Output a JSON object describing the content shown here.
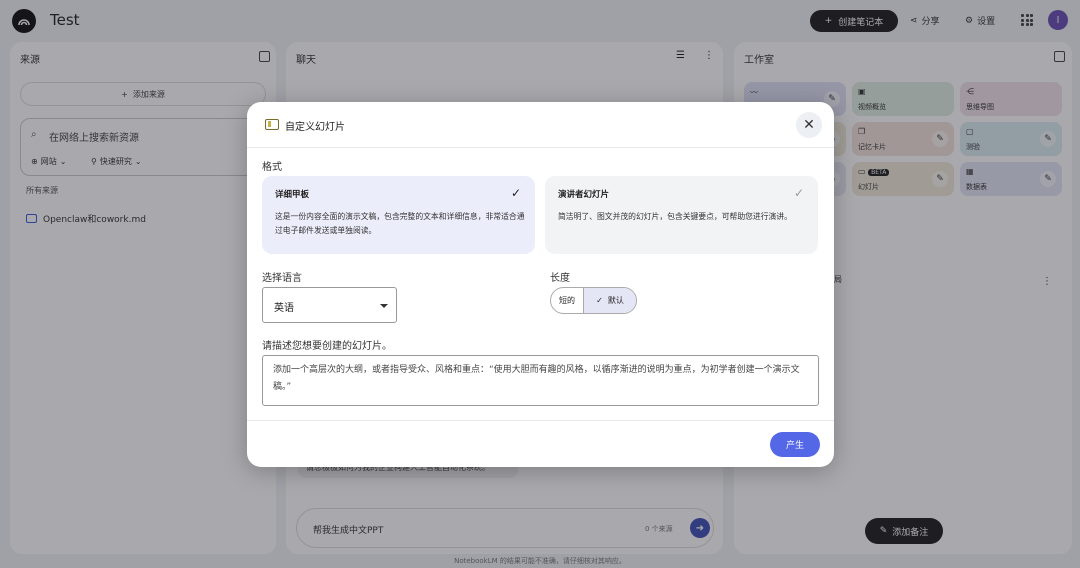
{
  "app": {
    "notebook_title": "Test",
    "create_label": "创建笔记本",
    "share_label": "分享",
    "settings_label": "设置",
    "avatar_initial": "I"
  },
  "sources": {
    "title": "来源",
    "add_label": "添加来源",
    "search_placeholder": "在网络上搜索新资源",
    "chip_web": "网站",
    "chip_research": "快速研究",
    "all_sources": "所有来源",
    "items": [
      {
        "name": "Openclaw和cowork.md"
      }
    ]
  },
  "chat": {
    "title": "聊天",
    "bubble_text": "请您极极如何为我的企业构建人工智能自动化系统。",
    "input_value": "帮我生成中文PPT",
    "source_count": "0 个来源"
  },
  "studio": {
    "title": "工作室",
    "tiles": [
      {
        "label": "",
        "icon": "audio-icon"
      },
      {
        "label": "视频概览",
        "icon": "video-icon"
      },
      {
        "label": "思维导图",
        "icon": "mindmap-icon"
      },
      {
        "label": "",
        "icon": "report-icon"
      },
      {
        "label": "记忆卡片",
        "icon": "flashcard-icon"
      },
      {
        "label": "测验",
        "icon": "quiz-icon"
      },
      {
        "label": "",
        "icon": "infographic-icon"
      },
      {
        "label": "幻灯片",
        "icon": "slides-icon",
        "badge": "BETA"
      },
      {
        "label": "数据表",
        "icon": "table-icon"
      }
    ],
    "note_text": "/......",
    "item_text": "局",
    "add_note_label": "添加备注"
  },
  "footer": {
    "text": "NotebookLM 的结果可能不准确，请仔细核对其响应。"
  },
  "dialog": {
    "title": "自定义幻灯片",
    "format_label": "格式",
    "formats": [
      {
        "title": "详细甲板",
        "desc": "这是一份内容全面的演示文稿，包含完整的文本和详细信息，非常适合通过电子邮件发送或单独阅读。",
        "selected": true
      },
      {
        "title": "演讲者幻灯片",
        "desc": "简洁明了、图文并茂的幻灯片，包含关键要点，可帮助您进行演讲。",
        "selected": false
      }
    ],
    "language_label": "选择语言",
    "language_value": "英语",
    "length_label": "长度",
    "length_short": "短的",
    "length_default": "默认",
    "describe_label": "请描述您想要创建的幻灯片。",
    "describe_placeholder": "添加一个高层次的大纲，或者指导受众、风格和重点：“使用大胆而有趣的风格，以循序渐进的说明为重点，为初学者创建一个演示文稿。”",
    "generate_label": "产生"
  },
  "colors": {
    "accent": "#5468e7",
    "selected_card": "#ecedfa",
    "dark_button": "#1f1f1f"
  }
}
